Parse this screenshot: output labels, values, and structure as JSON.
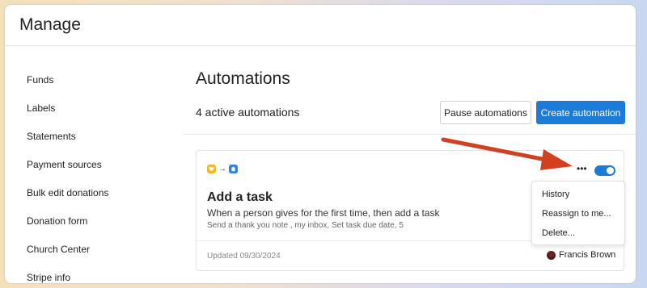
{
  "window": {
    "title": "Manage"
  },
  "sidebar": {
    "items": [
      {
        "label": "Funds"
      },
      {
        "label": "Labels"
      },
      {
        "label": "Statements"
      },
      {
        "label": "Payment sources"
      },
      {
        "label": "Bulk edit donations"
      },
      {
        "label": "Donation form"
      },
      {
        "label": "Church Center"
      },
      {
        "label": "Stripe info"
      }
    ]
  },
  "main": {
    "title": "Automations",
    "active_count_text": "4 active automations",
    "pause_label": "Pause automations",
    "create_label": "Create automation"
  },
  "automation": {
    "name": "Add a task",
    "description": "When a person gives for the first time, then add a task",
    "steps": "Send a thank you note , my inbox, Set task due date, 5",
    "updated": "Updated 09/30/2024",
    "owner": "Francis Brown",
    "more_glyph": "•••",
    "enabled": true,
    "trigger_icon": "heart-icon",
    "action_icon": "task-icon"
  },
  "menu": {
    "items": [
      {
        "label": "History"
      },
      {
        "label": "Reassign to me..."
      },
      {
        "label": "Delete..."
      }
    ]
  },
  "colors": {
    "primary": "#1b7bd6",
    "trigger": "#f2b824",
    "action": "#2f80ed",
    "annotation_arrow": "#d1401f"
  }
}
